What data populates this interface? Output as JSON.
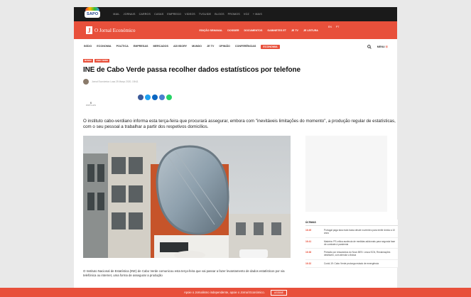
{
  "sapo_bar": {
    "logo": "SAPO",
    "links": [
      "MAIL",
      "JORNAIS",
      "CARROS",
      "CASAS",
      "EMPREGO",
      "VIDEOS",
      "TVGUIDE",
      "BLOGS",
      "PROMOS",
      "VOZ",
      "+ MAIS"
    ]
  },
  "header": {
    "brand_mark": "J",
    "brand": "O Jornal Económico",
    "links": [
      "EDIÇÃO SEMANAL",
      "DOSSIER",
      "DOCUMENTOS",
      "GABINETES ET",
      "JE TV",
      "JE LEITURA"
    ],
    "lang": [
      "EN",
      "PT"
    ]
  },
  "nav": {
    "items": [
      "INÍCIO",
      "ECONOMIA",
      "POLÍTICA",
      "EMPRESAS",
      "MERCADOS",
      "ADVISORY",
      "MUNDO",
      "JE TV",
      "OPINIÃO",
      "CONFERÊNCIAS"
    ],
    "highlight": "ECONOMIA",
    "search_icon": "search-icon",
    "menu": "MENU",
    "menu_icon": "menu-icon"
  },
  "article": {
    "tags": [
      "MUNDO",
      "CABO VERDE"
    ],
    "title": "INE de Cabo Verde passa recolher dados estatísticos por telefone",
    "author": "Jornal Económico  Lusa  25 Março 2020, 15h11",
    "shares_count": "6",
    "shares_label": "PARTILHAS",
    "social_icons": [
      "facebook-icon",
      "twitter-icon",
      "linkedin-icon",
      "email-icon",
      "whatsapp-icon"
    ],
    "lead": "O instituto cabo-verdiano informa esta terça-feira que procurará assegurar, embora com \"inevitáveis limitações do momento\", a produção regular de estatísticas, com o seu pessoal a trabalhar a partir dos respetivos domicílios.",
    "body": "O Instituto Nacional de Estatística (INE) de Cabo Verde comunicou esta terça-feira que vai passar a fazer levantamento de dados estatísticos por via telefónica ou internet, uma forma de assegurar a produção"
  },
  "sidebar": {
    "title": "ÚLTIMAS",
    "items": [
      {
        "time": "16:49",
        "headline": "Portugal paga taxa mais baixa desde novembro para emitir dívida a 10 anos"
      },
      {
        "time": "16:41",
        "headline": "Madeira: PS critica ausência de medidas adicionais para segunda fase de combate à pandemia"
      },
      {
        "time": "16:38",
        "headline": "Pressão por ressarcidos do Novo BES: Lesca SCN, Reclamações destituem, com atendor a lisboa"
      },
      {
        "time": "16:32",
        "headline": "Covid-19: Cabo Verde prolonga estado de emergência"
      }
    ]
  },
  "banner": {
    "text": "Apoie o Jornalismo independente, apoie o Jornal Económico.",
    "button": "ASSINE"
  },
  "colors": {
    "accent": "#e8503b",
    "dark": "#1a1a1a"
  }
}
